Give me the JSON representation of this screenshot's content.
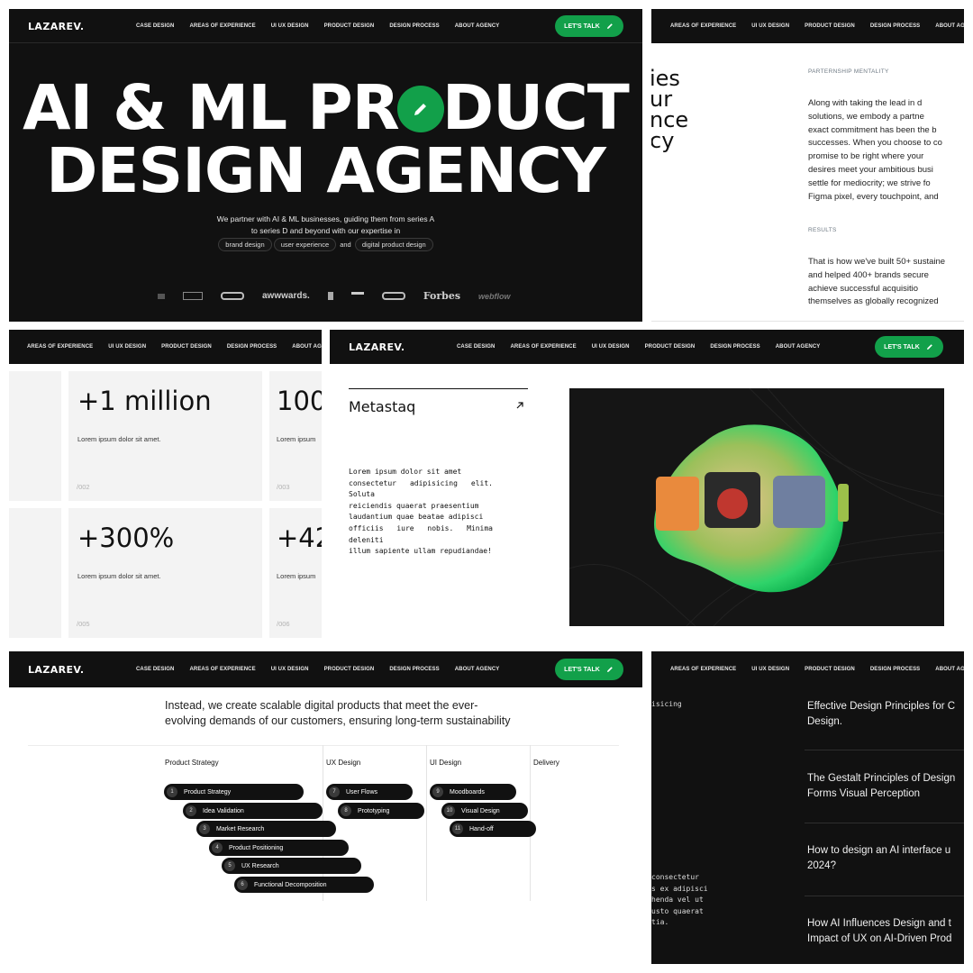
{
  "brand": "LAZAREV.",
  "nav_links": [
    "CASE DESIGN",
    "AREAS OF EXPERIENCE",
    "UI UX DESIGN",
    "PRODUCT DESIGN",
    "DESIGN PROCESS",
    "ABOUT AGENCY"
  ],
  "cta_label": "LET'S TALK",
  "hero": {
    "title_line1_a": "AI & ML PR",
    "title_line1_b": "DUCT",
    "title_line2": "DESIGN AGENCY",
    "subtitle_line1": "We partner with AI & ML businesses, guiding them from series A",
    "subtitle_line2": "to series D and beyond with our expertise in",
    "pill_1": "brand design",
    "pill_2": "user experience",
    "pill_and": "and",
    "pill_3": "digital product design",
    "logos": [
      "awwwards.",
      "Forbes",
      "webflow"
    ]
  },
  "partnership": {
    "heading_fragments": [
      "ies",
      "ur",
      "nce",
      "cy"
    ],
    "label_1": "PARTERNSHIP MENTALITY",
    "para_1": [
      "Along with taking the lead in d",
      "solutions, we embody a partne",
      "exact commitment has been the b",
      "successes. When you choose to co",
      "promise to be right where your",
      "desires meet your ambitious busi",
      "settle for mediocrity; we strive fo",
      "Figma pixel, every touchpoint, and"
    ],
    "label_2": "RESULTS",
    "para_2": [
      "That is how we've built 50+ sustaine",
      "and helped 400+ brands secure",
      "achieve successful acquisitio",
      "themselves as globally recognized"
    ]
  },
  "stats": [
    {
      "value": "+1 million",
      "desc": "Lorem ipsum dolor sit amet.",
      "idx": "/002"
    },
    {
      "value": "100",
      "desc": "Lorem ipsum",
      "idx": "/003"
    },
    {
      "value": "+300%",
      "desc": "Lorem ipsum dolor sit amet.",
      "idx": "/005"
    },
    {
      "value": "+42",
      "desc": "Lorem ipsum",
      "idx": "/006"
    }
  ],
  "case": {
    "title": "Metastaq",
    "text": [
      "Lorem ipsum dolor sit amet",
      "consectetur adipisicing elit. Soluta",
      "reiciendis quaerat praesentium",
      "laudantium quae beatae adipisci",
      "officiis iure nobis. Minima deleniti",
      "illum sapiente ullam repudiandae!"
    ]
  },
  "process": {
    "intro_line1": "Instead, we create scalable digital products that meet the ever-",
    "intro_line2": "evolving demands of our customers, ensuring long-term sustainability",
    "columns": [
      "Product Strategy",
      "UX Design",
      "UI Design",
      "Delivery"
    ],
    "steps": [
      {
        "n": "1",
        "label": "Product Strategy"
      },
      {
        "n": "2",
        "label": "Idea Validation"
      },
      {
        "n": "3",
        "label": "Market Research"
      },
      {
        "n": "4",
        "label": "Product Positioning"
      },
      {
        "n": "5",
        "label": "UX Research"
      },
      {
        "n": "6",
        "label": "Functional Decomposition"
      },
      {
        "n": "7",
        "label": "User Flows"
      },
      {
        "n": "8",
        "label": "Prototyping"
      },
      {
        "n": "9",
        "label": "Moodboards"
      },
      {
        "n": "10",
        "label": "Visual Design"
      },
      {
        "n": "11",
        "label": "Hand-off"
      }
    ]
  },
  "articles": {
    "left_fragment_top": "isicing",
    "left_fragment_body": [
      "consectetur",
      "s ex adipisci",
      "henda vel ut",
      "usto quaerat",
      "tia."
    ],
    "items": [
      [
        "Effective Design Principles for C",
        "Design."
      ],
      [
        "The Gestalt Principles of Design",
        "Forms Visual Perception"
      ],
      [
        "How to design an AI interface u",
        "2024?"
      ],
      [
        "How AI Influences Design and t",
        "Impact of UX on AI-Driven Prod"
      ]
    ]
  },
  "colors": {
    "accent": "#12a04a",
    "dark": "#111111",
    "card": "#f3f3f3"
  }
}
